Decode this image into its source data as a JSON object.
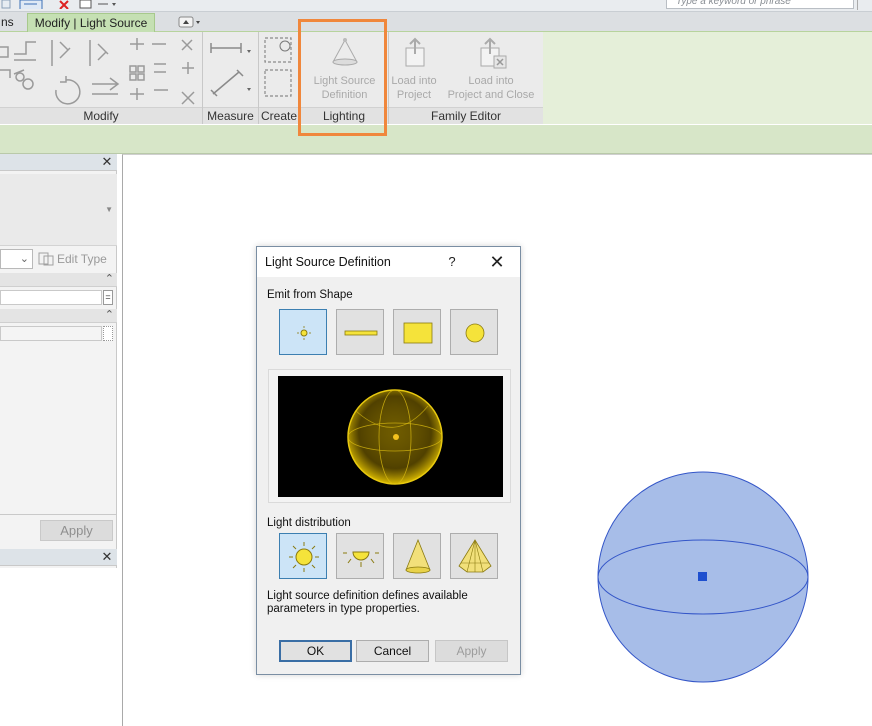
{
  "quick_access": {
    "search_placeholder": "Type a keyword or phrase"
  },
  "tabs": {
    "partial_tab": "ns",
    "active_tab": "Modify | Light Source"
  },
  "ribbon": {
    "panels": {
      "modify": "Modify",
      "measure": "Measure",
      "create": "Create",
      "lighting": "Lighting",
      "family_editor": "Family Editor"
    },
    "buttons": {
      "light_source_definition": [
        "Light Source",
        "Definition"
      ],
      "load_into_project": [
        "Load into",
        "Project"
      ],
      "load_into_project_close": [
        "Load into",
        "Project and Close"
      ]
    }
  },
  "properties": {
    "edit_type": "Edit Type",
    "apply": "Apply"
  },
  "dialog": {
    "title": "Light Source Definition",
    "help": "?",
    "emit_label": "Emit from Shape",
    "emit_shapes": [
      "point",
      "line",
      "rectangle",
      "circle"
    ],
    "selected_shape": "point",
    "distribution_label": "Light distribution",
    "distributions": [
      "spherical",
      "hemispherical",
      "spot",
      "photometric web"
    ],
    "selected_distribution": "spherical",
    "description": "Light source definition defines available parameters in type properties.",
    "ok": "OK",
    "cancel": "Cancel",
    "apply": "Apply"
  },
  "colors": {
    "highlight": "#f0873c",
    "sphere_fill": "#a7bde8",
    "sphere_stroke": "#3456c8",
    "light_yellow": "#f5e33a",
    "contextual_tab": "#c5e0b3"
  }
}
